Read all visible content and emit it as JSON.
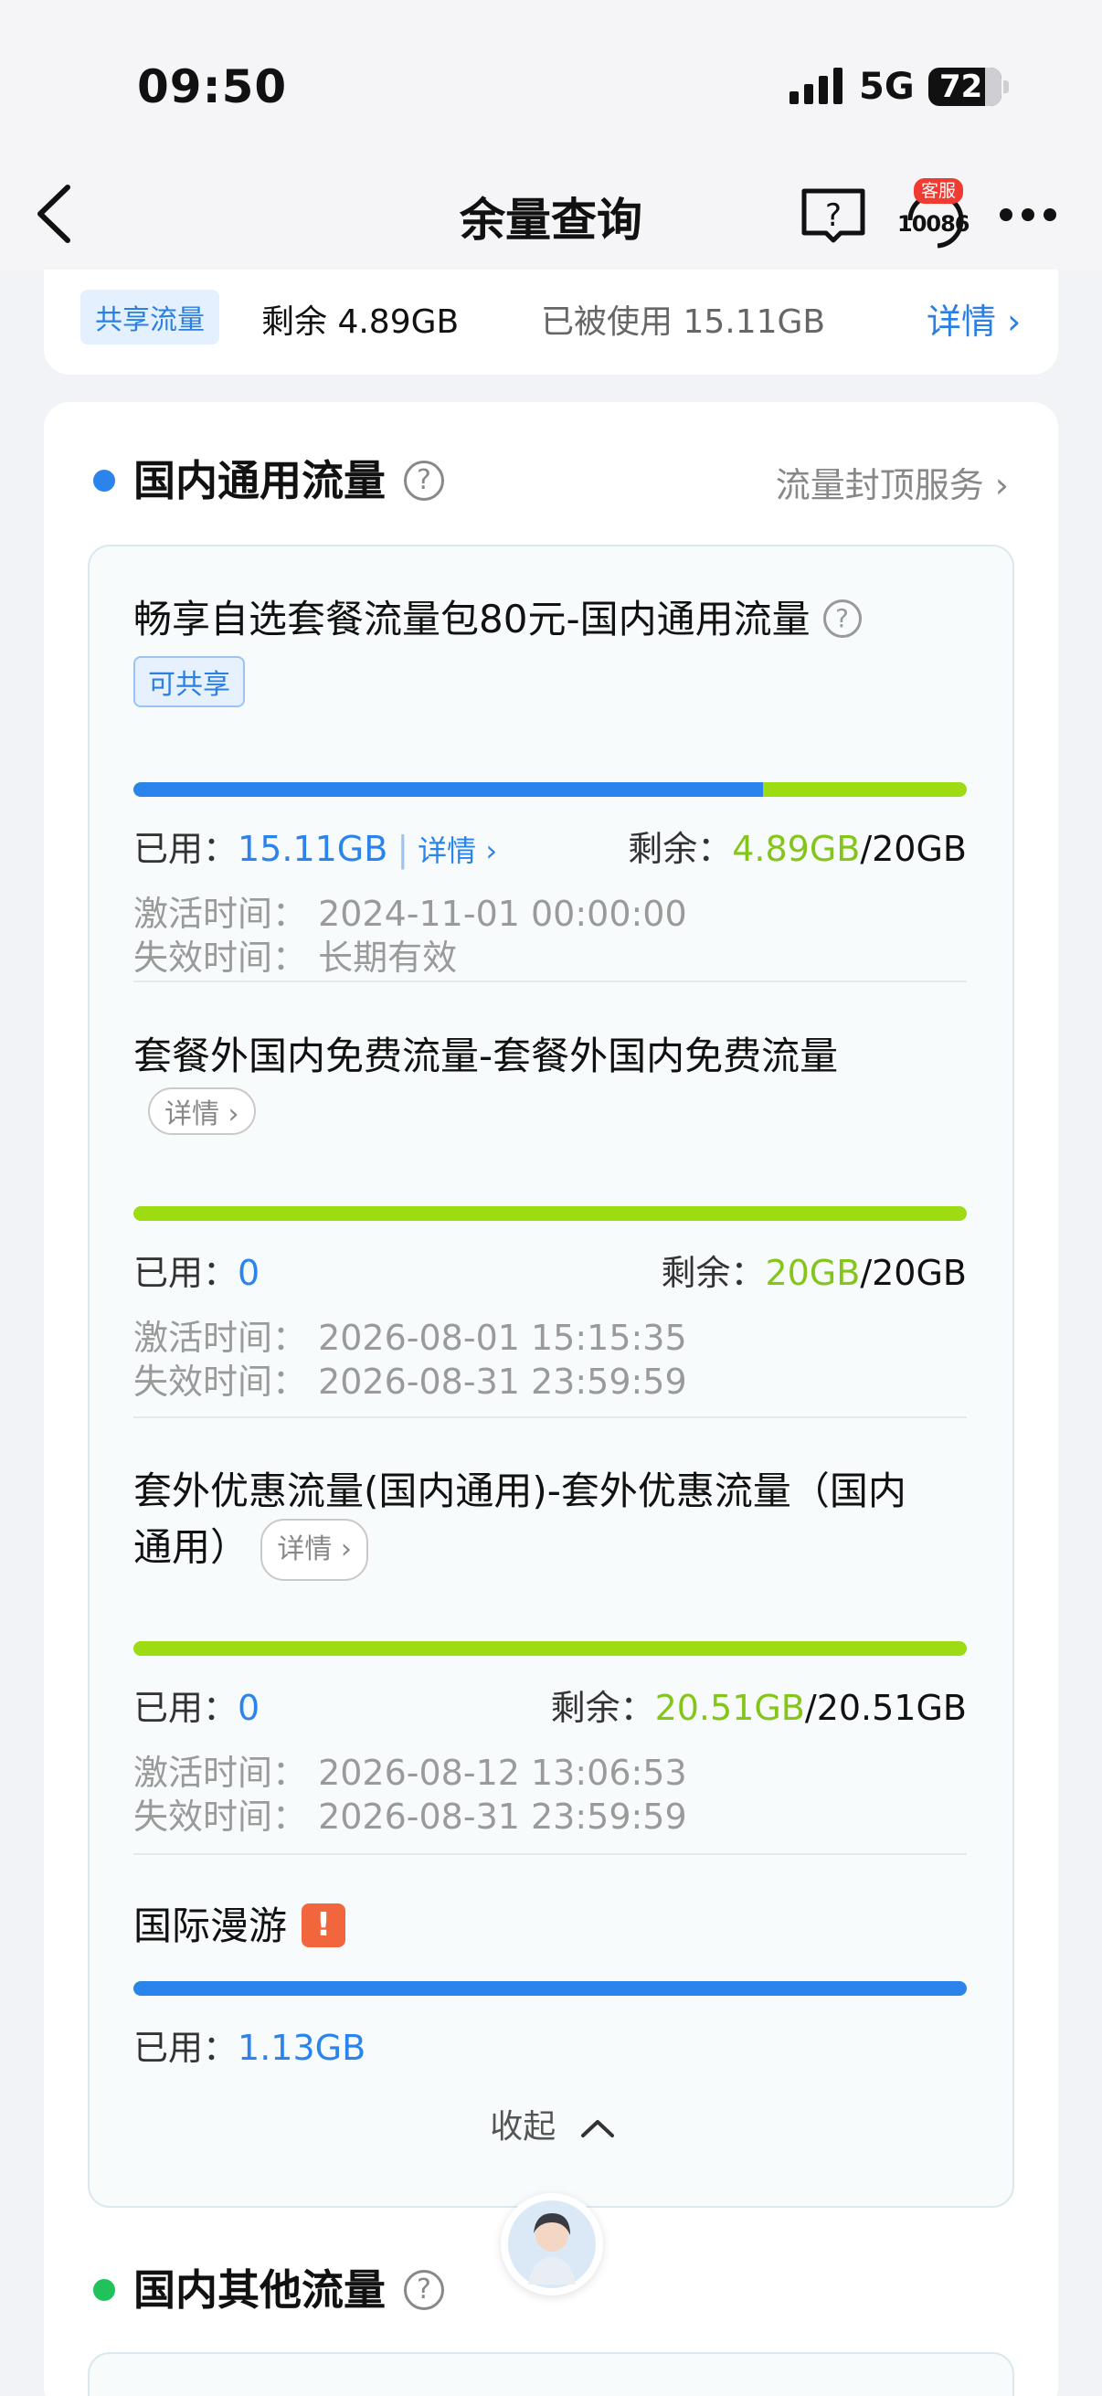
{
  "status": {
    "time": "09:50",
    "network": "5G",
    "battery": "72"
  },
  "nav": {
    "title": "余量查询",
    "help_glyph": "?",
    "cs_badge": "客服",
    "cs_number": "10086"
  },
  "summary": {
    "tag": "共享流量",
    "remain": "剩余 4.89GB",
    "used": "已被使用 15.11GB",
    "detail": "详情 ›"
  },
  "section1": {
    "title": "国内通用流量",
    "link": "流量封顶服务 ›"
  },
  "items": [
    {
      "title": "畅享自选套餐流量包80元-国内通用流量",
      "tag": "可共享",
      "used_label": "已用：",
      "used_value": "15.11GB",
      "detail_link": "详情 ›",
      "remain_label": "剩余：",
      "remain_value": "4.89GB",
      "total": "/20GB",
      "used_fraction": 0.755,
      "activate": "激活时间： 2024-11-01 00:00:00",
      "expire": "失效时间： 长期有效"
    },
    {
      "title": "套餐外国内免费流量-套餐外国内免费流量",
      "detail_pill": "详情 ›",
      "used_label": "已用：",
      "used_value": "0",
      "remain_label": "剩余：",
      "remain_value": "20GB",
      "total": "/20GB",
      "used_fraction": 0,
      "activate": "激活时间： 2026-08-01 15:15:35",
      "expire": "失效时间： 2026-08-31 23:59:59"
    },
    {
      "title_line1": "套外优惠流量(国内通用)-套外优惠流量（国内",
      "title_line2": "通用）",
      "detail_pill": "详情 ›",
      "used_label": "已用：",
      "used_value": "0",
      "remain_label": "剩余：",
      "remain_value": "20.51GB",
      "total": "/20.51GB",
      "used_fraction": 0,
      "activate": "激活时间： 2026-08-12 13:06:53",
      "expire": "失效时间： 2026-08-31 23:59:59"
    },
    {
      "title": "国际漫游",
      "warn_glyph": "!",
      "used_label": "已用：",
      "used_value": "1.13GB",
      "used_fraction": 1
    }
  ],
  "collapse_label": "收起",
  "section2": {
    "title": "国内其他流量"
  },
  "colors": {
    "blue": "#2a84ec",
    "green": "#84c51a",
    "section1_dot": "#2a84ec",
    "section2_dot": "#22c25a"
  }
}
